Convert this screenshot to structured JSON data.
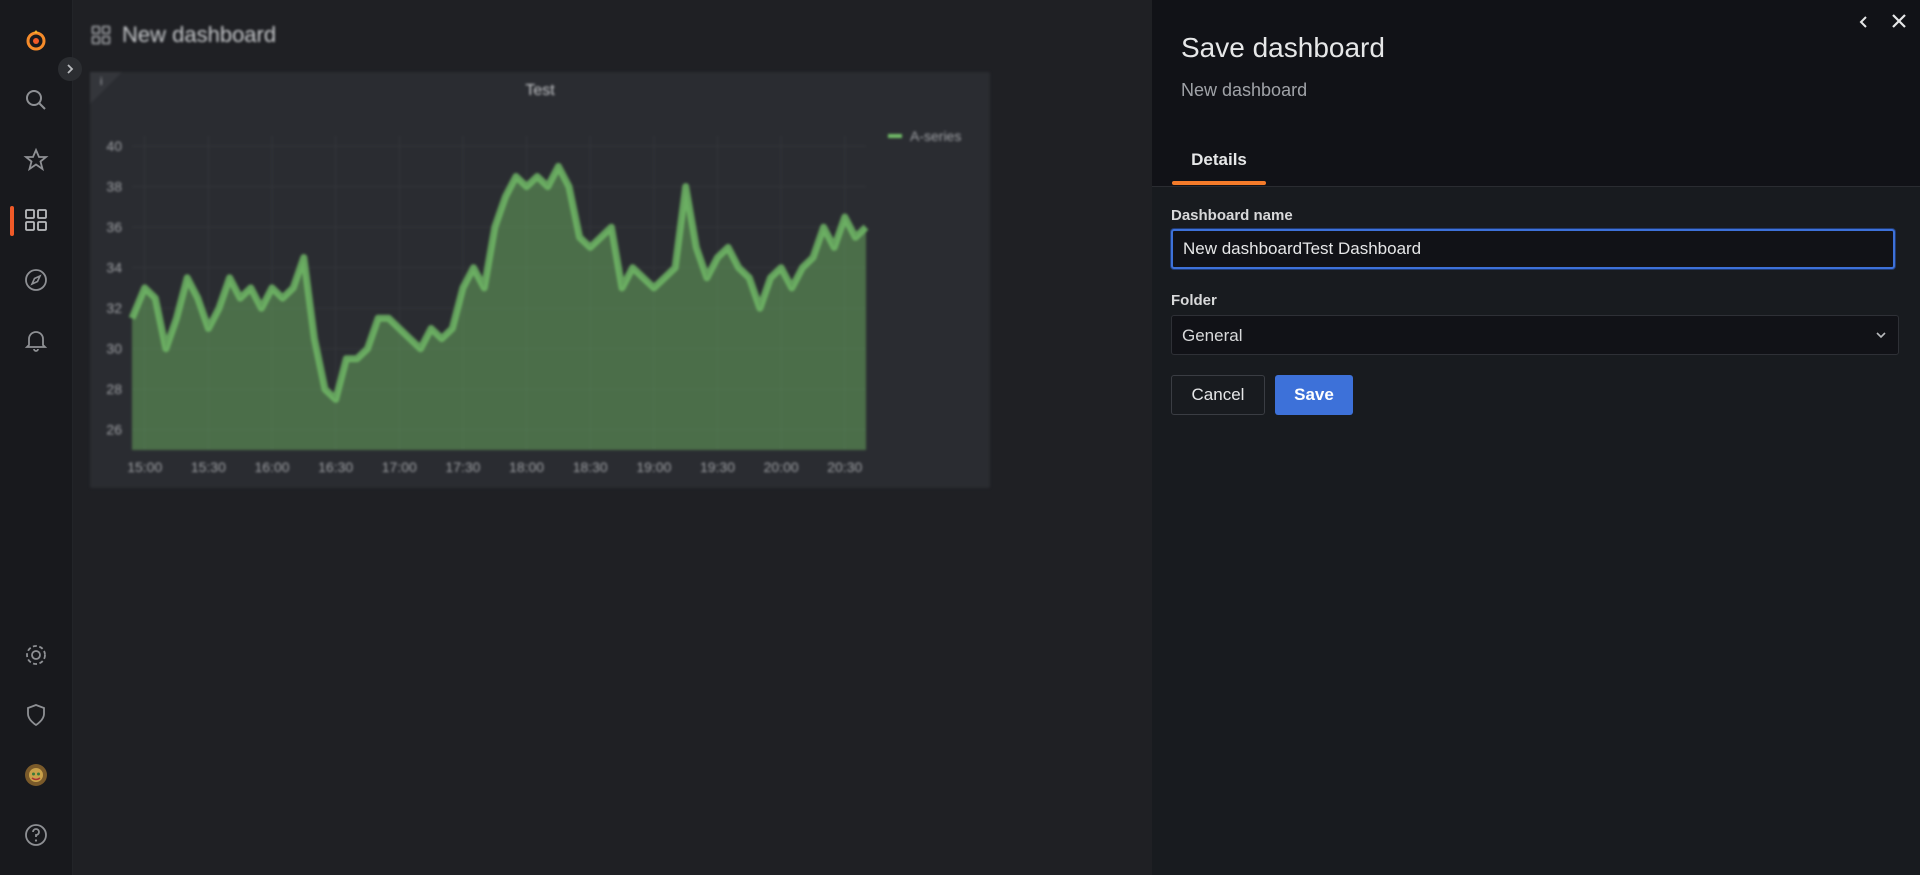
{
  "dashboard": {
    "title": "New dashboard",
    "panel": {
      "title": "Test",
      "info_marker": "i"
    }
  },
  "chart_data": {
    "type": "area",
    "title": "Test",
    "series": [
      {
        "name": "A-series",
        "color": "#73bf69",
        "x": [
          "14:54",
          "15:00",
          "15:05",
          "15:10",
          "15:15",
          "15:20",
          "15:25",
          "15:30",
          "15:35",
          "15:40",
          "15:45",
          "15:50",
          "15:55",
          "16:00",
          "16:05",
          "16:10",
          "16:15",
          "16:20",
          "16:25",
          "16:30",
          "16:35",
          "16:40",
          "16:45",
          "16:50",
          "16:55",
          "17:00",
          "17:05",
          "17:10",
          "17:15",
          "17:20",
          "17:25",
          "17:30",
          "17:35",
          "17:40",
          "17:45",
          "17:50",
          "17:55",
          "18:00",
          "18:05",
          "18:10",
          "18:15",
          "18:20",
          "18:25",
          "18:30",
          "18:35",
          "18:40",
          "18:45",
          "18:50",
          "18:55",
          "19:00",
          "19:05",
          "19:10",
          "19:15",
          "19:20",
          "19:25",
          "19:30",
          "19:35",
          "19:40",
          "19:45",
          "19:50",
          "19:55",
          "20:00",
          "20:05",
          "20:10",
          "20:15",
          "20:20",
          "20:25",
          "20:30",
          "20:35",
          "20:40"
        ],
        "values": [
          31.5,
          33,
          32.5,
          30,
          31.5,
          33.5,
          32.5,
          31,
          32,
          33.5,
          32.5,
          33,
          32,
          33,
          32.5,
          33,
          34.5,
          30.5,
          28,
          27.5,
          29.5,
          29.5,
          30,
          31.5,
          31.5,
          31,
          30.5,
          30,
          31,
          30.5,
          31,
          33,
          34,
          33,
          36,
          37.5,
          38.5,
          38,
          38.5,
          38,
          39,
          38,
          35.5,
          35,
          35.5,
          36,
          33,
          34,
          33.5,
          33,
          33.5,
          34,
          38,
          35,
          33.5,
          34.5,
          35,
          34,
          33.5,
          32,
          33.5,
          34,
          33,
          34,
          34.5,
          36,
          35,
          36.5,
          35.5,
          36
        ]
      }
    ],
    "x_ticks": [
      "15:00",
      "15:30",
      "16:00",
      "16:30",
      "17:00",
      "17:30",
      "18:00",
      "18:30",
      "19:00",
      "19:30",
      "20:00",
      "20:30"
    ],
    "y_ticks": [
      26,
      28,
      30,
      32,
      34,
      36,
      38,
      40
    ],
    "ylim": [
      25,
      40.5
    ],
    "grid": true,
    "legend": "top-right"
  },
  "drawer": {
    "title": "Save dashboard",
    "subtitle": "New dashboard",
    "tabs": [
      {
        "label": "Details",
        "active": true
      }
    ],
    "fields": {
      "name_label": "Dashboard name",
      "name_value": "New dashboardTest Dashboard",
      "folder_label": "Folder",
      "folder_value": "General"
    },
    "buttons": {
      "cancel": "Cancel",
      "save": "Save"
    }
  },
  "colors": {
    "accent": "#3d71d9",
    "brand": "#f05a28",
    "tab_underline": "#f47b2a",
    "series": "#73bf69"
  }
}
